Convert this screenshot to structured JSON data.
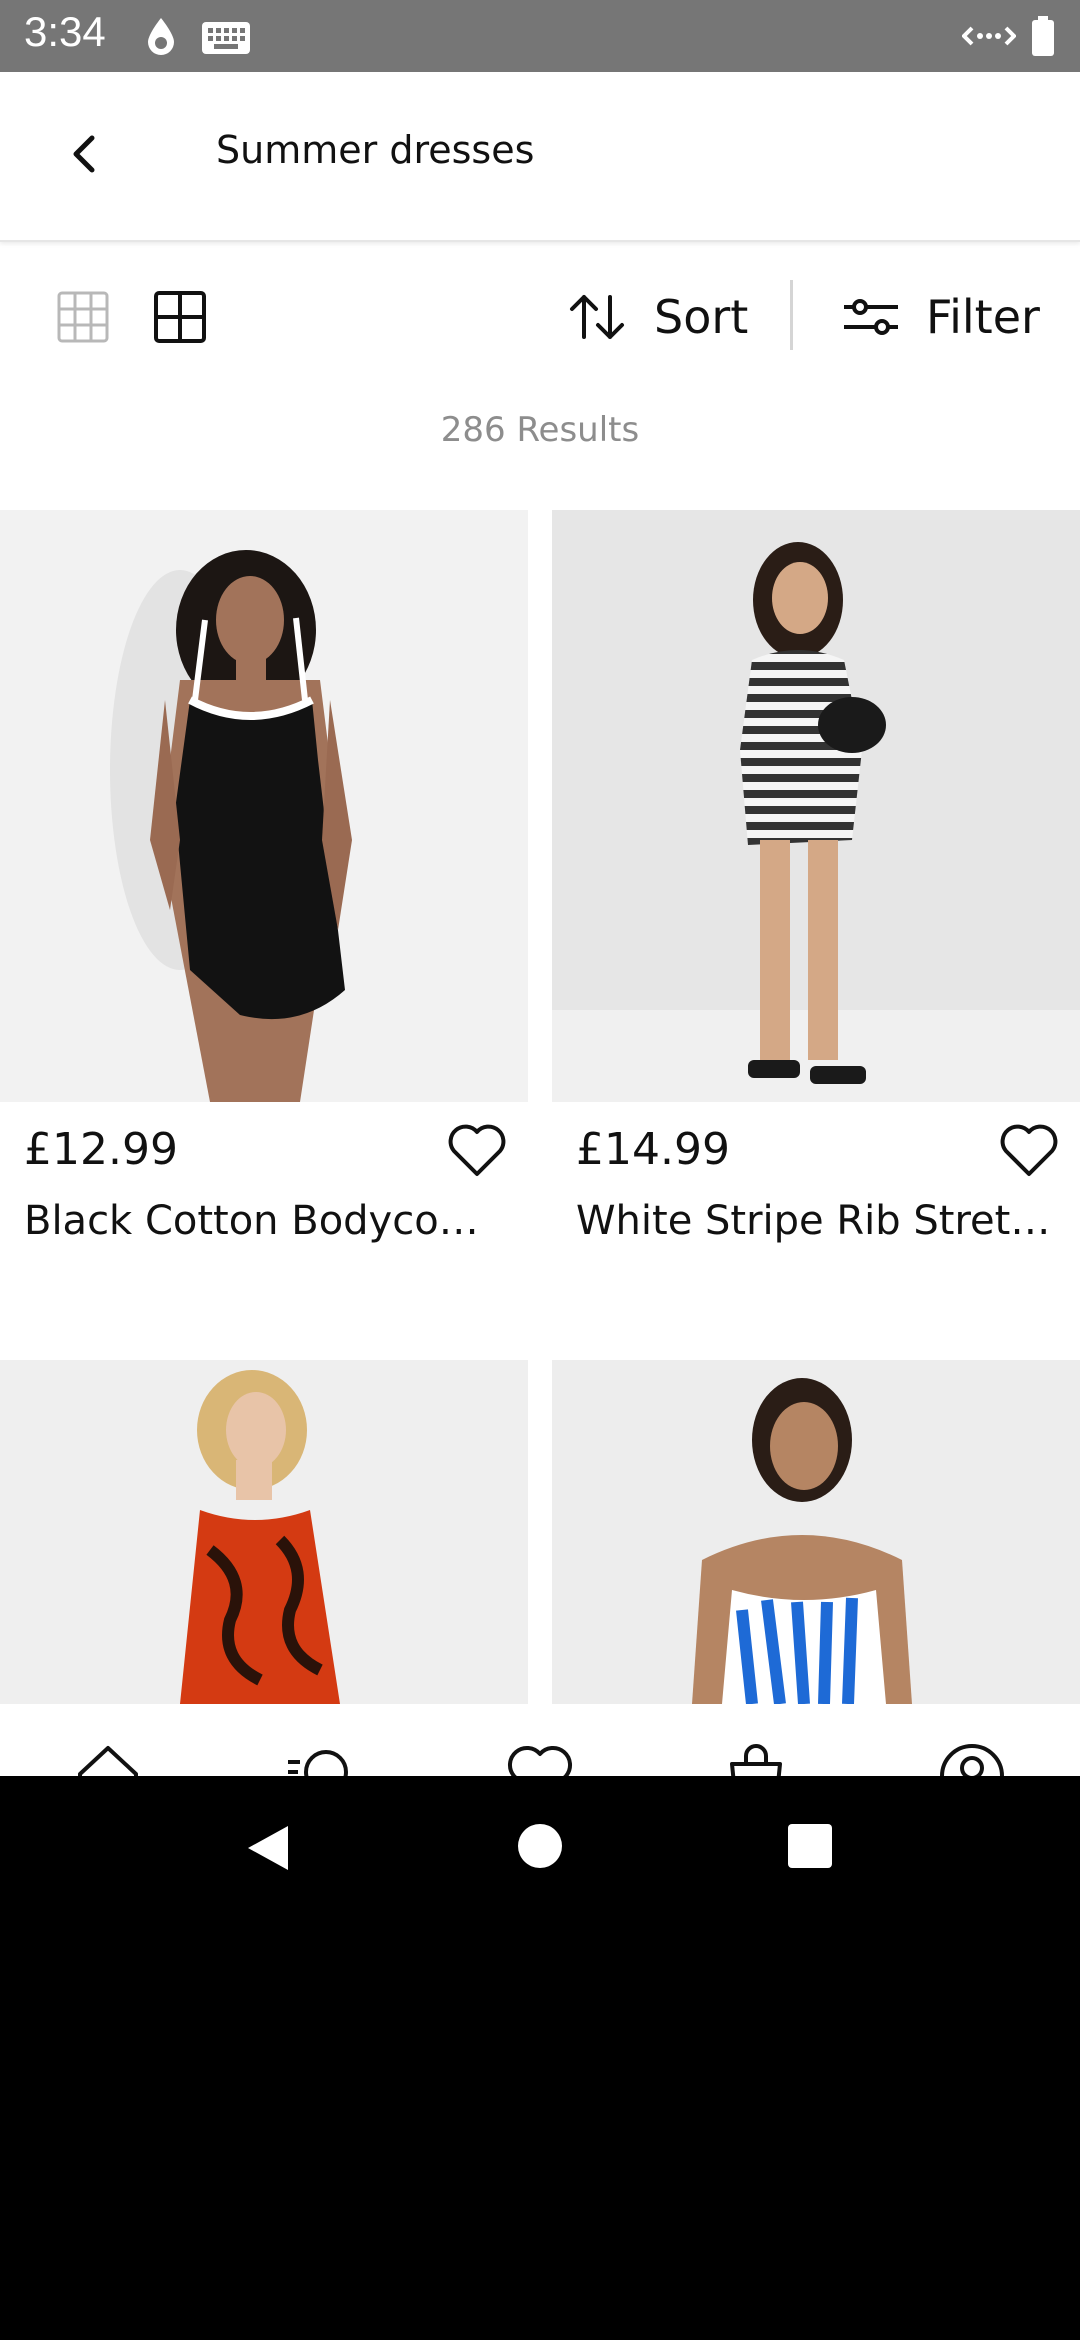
{
  "status_bar": {
    "time": "3:34"
  },
  "header": {
    "title": "Summer dresses"
  },
  "toolbar": {
    "sort_label": "Sort",
    "filter_label": "Filter"
  },
  "results_label": "286 Results",
  "products": [
    {
      "price": "£12.99",
      "name": "Black Cotton Bodycon ..."
    },
    {
      "price": "£14.99",
      "name": "White Stripe Rib Stretc..."
    }
  ],
  "colors": {
    "status_bar": "#767676",
    "text": "#111111",
    "muted": "#8d8d8d"
  },
  "icons": [
    "back-arrow-icon",
    "grid-3x3-icon",
    "grid-2x2-icon",
    "sort-arrows-icon",
    "filter-sliders-icon",
    "heart-icon",
    "home-icon",
    "search-icon",
    "bag-icon",
    "account-icon"
  ]
}
